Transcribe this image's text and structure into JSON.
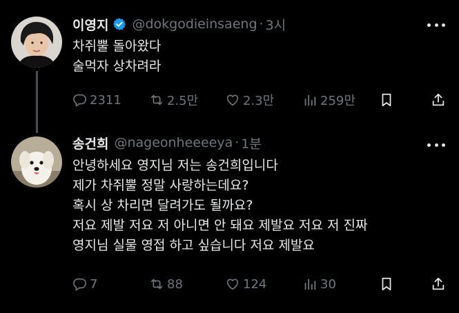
{
  "tweets": [
    {
      "name": "이영지",
      "verified": true,
      "handle": "@dokgodieinsaeng",
      "separator": "·",
      "time": "3시",
      "text_lines": [
        "차쥐뿔 돌아왔다",
        "술먹자 상차려라"
      ],
      "stats": {
        "replies": "2311",
        "retweets": "2.5만",
        "likes": "2.3만",
        "views": "259만"
      }
    },
    {
      "name": "송건희",
      "verified": false,
      "handle": "@nageonheeeeya",
      "separator": "·",
      "time": "1분",
      "text_lines": [
        "안녕하세요 영지님 저는 송건희입니다",
        "제가 차쥐뿔 정말 사랑하는데요?",
        "혹시 상 차리면 달려가도 될까요?",
        "저요 제발 저요 저 아니면 안 돼요 제발요 저요 저 진짜",
        "영지님 실물 영접 하고 싶습니다 저요 제발요"
      ],
      "stats": {
        "replies": "7",
        "retweets": "88",
        "likes": "124",
        "views": "30"
      }
    }
  ],
  "colors": {
    "background": "#000000",
    "text": "#e7e9ea",
    "muted": "#71767b",
    "verified": "#1d9bf0",
    "thread_line": "#4a4f55"
  },
  "icons": [
    "reply-icon",
    "retweet-icon",
    "like-icon",
    "views-icon",
    "bookmark-icon",
    "share-icon",
    "more-icon",
    "verified-icon"
  ]
}
